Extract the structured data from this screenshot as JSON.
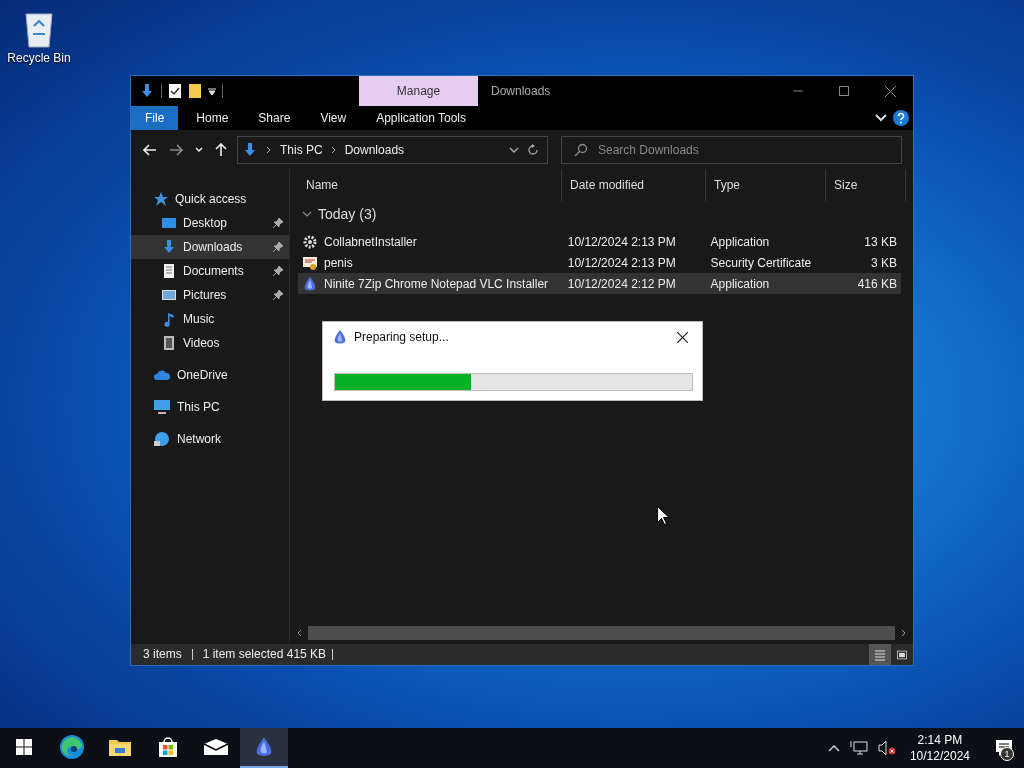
{
  "desktop_icons": [
    {
      "label": "Recycle Bin"
    }
  ],
  "window": {
    "title": "Downloads",
    "contextual_tab": "Manage"
  },
  "ribbon_tabs": [
    {
      "label": "File",
      "kind": "file"
    },
    {
      "label": "Home",
      "kind": "tab"
    },
    {
      "label": "Share",
      "kind": "tab"
    },
    {
      "label": "View",
      "kind": "tab"
    },
    {
      "label": "Application Tools",
      "kind": "tab"
    }
  ],
  "address_bar": {
    "crumbs": [
      "This PC",
      "Downloads"
    ]
  },
  "search": {
    "placeholder": "Search Downloads"
  },
  "navigation": [
    {
      "label": "Quick access",
      "kind": "star",
      "selected": false,
      "children": [
        {
          "label": "Desktop",
          "kind": "desktop",
          "selected": false,
          "pinned": true
        },
        {
          "label": "Downloads",
          "kind": "downloads",
          "selected": true,
          "pinned": true
        },
        {
          "label": "Documents",
          "kind": "documents",
          "selected": false,
          "pinned": true
        },
        {
          "label": "Pictures",
          "kind": "pictures",
          "selected": false,
          "pinned": true
        },
        {
          "label": "Music",
          "kind": "music",
          "selected": false,
          "pinned": false
        },
        {
          "label": "Videos",
          "kind": "videos",
          "selected": false,
          "pinned": false
        }
      ]
    },
    {
      "label": "OneDrive",
      "kind": "cloud",
      "selected": false
    },
    {
      "label": "This PC",
      "kind": "pc",
      "selected": false
    },
    {
      "label": "Network",
      "kind": "network",
      "selected": false
    }
  ],
  "table": {
    "columns": [
      "Name",
      "Date modified",
      "Type",
      "Size"
    ],
    "groups": [
      {
        "label": "Today (3)",
        "expanded": true,
        "rows": [
          {
            "name": "CollabnetInstaller",
            "date_modified": "10/12/2024 2:13 PM",
            "type": "Application",
            "size": "13 KB",
            "kind": "gear",
            "selected": false
          },
          {
            "name": "penis",
            "date_modified": "10/12/2024 2:13 PM",
            "type": "Security Certificate",
            "size": "3 KB",
            "kind": "certificate",
            "selected": false
          },
          {
            "name": "Ninite 7Zip Chrome Notepad VLC Installer",
            "date_modified": "10/12/2024 2:12 PM",
            "type": "Application",
            "size": "416 KB",
            "kind": "ninite",
            "selected": true
          }
        ]
      }
    ]
  },
  "status_bar": {
    "items": "3 items",
    "selection": "1 item selected  415 KB"
  },
  "dialog": {
    "title": "Preparing setup...",
    "level": 0.38
  },
  "taskbar": {
    "apps": [
      {
        "kind": "start",
        "selected": false
      },
      {
        "kind": "edge",
        "selected": false
      },
      {
        "kind": "explorer",
        "selected": false
      },
      {
        "kind": "store",
        "selected": false
      },
      {
        "kind": "mail",
        "selected": false
      },
      {
        "kind": "ninite",
        "selected": true
      }
    ],
    "time": "2:14 PM",
    "date": "10/12/2024",
    "notifications": "1"
  }
}
